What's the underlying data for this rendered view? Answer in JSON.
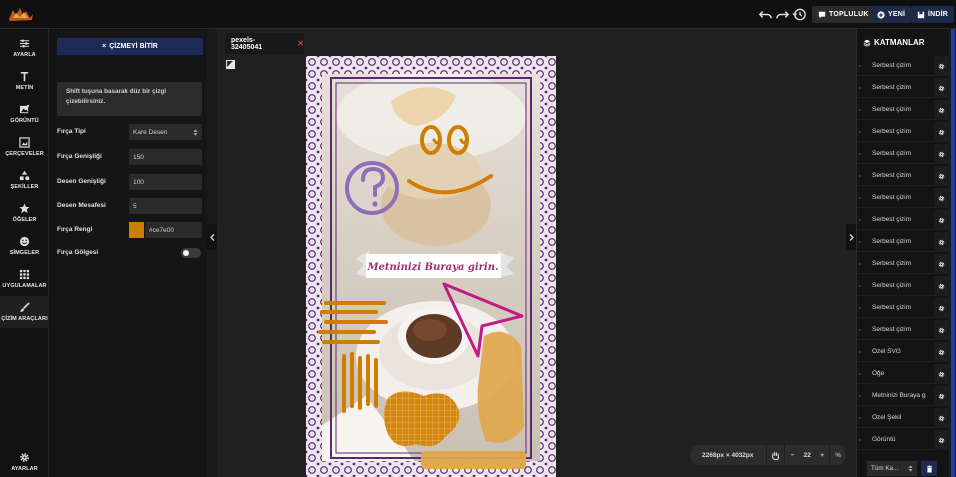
{
  "topbar": {
    "logo_label": "logo",
    "community_label": "TOPLULUK",
    "new_label": "YENİ",
    "download_label": "İNDİR"
  },
  "iconbar": {
    "items": [
      {
        "label": "AYARLA",
        "icon": "sliders-icon"
      },
      {
        "label": "METİN",
        "icon": "text-icon"
      },
      {
        "label": "GÖRÜNTÜ",
        "icon": "image-icon"
      },
      {
        "label": "ÇERÇEVELER",
        "icon": "frame-icon"
      },
      {
        "label": "ŞEKİLLER",
        "icon": "shapes-icon"
      },
      {
        "label": "ÖĞELER",
        "icon": "star-icon"
      },
      {
        "label": "SİMGELER",
        "icon": "smile-icon"
      },
      {
        "label": "UYGULAMALAR",
        "icon": "grid-icon"
      },
      {
        "label": "ÇİZİM ARAÇLARI",
        "icon": "brush-icon"
      }
    ],
    "settings_label": "AYARLAR"
  },
  "tool_panel": {
    "finish_label": "ÇİZMEYİ BİTİR",
    "hint": "Shift tuşuna basarak düz bir çizgi çizebilirsiniz.",
    "brush_type_label": "Fırça Tipi",
    "brush_type_value": "Kare Desen",
    "brush_width_label": "Fırça Genişliği",
    "brush_width_value": "150",
    "pattern_width_label": "Desen Genişliği",
    "pattern_width_value": "100",
    "pattern_distance_label": "Desen Mesafesi",
    "pattern_distance_value": "5",
    "brush_color_label": "Fırça Rengi",
    "brush_color_value": "#ce7e00",
    "brush_shadow_label": "Fırça Gölgesi",
    "brush_shadow_on": false
  },
  "canvas": {
    "tab_title": "pexels-32405041",
    "banner_text": "Metninizi Buraya girin.",
    "accent_color": "#ce7e00",
    "frame_color": "#5a2a6e"
  },
  "zoom": {
    "dimensions": "2268px × 4032px",
    "level": "22",
    "unit": "%"
  },
  "layers": {
    "title": "KATMANLAR",
    "items": [
      "Serbest çizim",
      "Serbest çizim",
      "Serbest çizim",
      "Serbest çizim",
      "Serbest çizim",
      "Serbest çizim",
      "Serbest çizim",
      "Serbest çizim",
      "Serbest çizim",
      "Serbest çizim",
      "Serbest çizim",
      "Serbest çizim",
      "Serbest çizim",
      "Özel SVG",
      "Öğe",
      "Metninizi Buraya g",
      "Özel Şekil",
      "Görüntü"
    ],
    "filter_label": "Tüm Ka..."
  }
}
